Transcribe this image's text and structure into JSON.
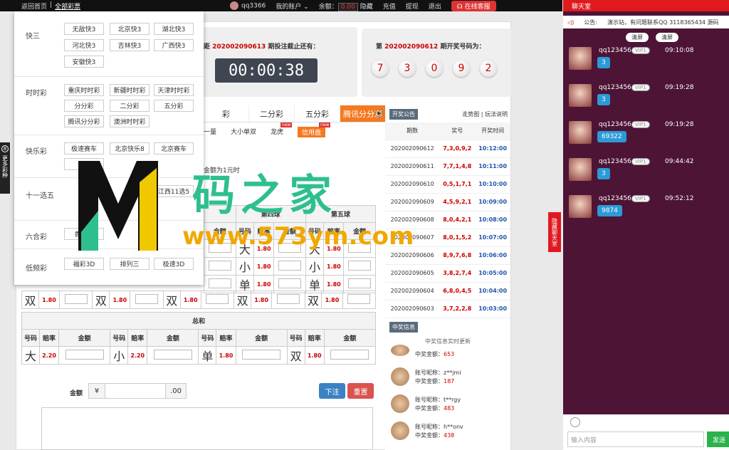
{
  "topbar": {
    "home": "返回首页",
    "sep": "|",
    "all_lottery": "全部彩票",
    "username": "qq3366",
    "my_account": "我的账户",
    "balance_label": "余额：",
    "balance_value": "0.00",
    "hide": "隐藏",
    "recharge": "充值",
    "withdraw": "提现",
    "logout": "退出",
    "service": "在线客服"
  },
  "menu": {
    "groups": [
      {
        "label": "快三",
        "items": [
          "无敌快3",
          "北京快3",
          "湖北快3",
          "河北快3",
          "吉林快3",
          "广西快3",
          "安徽快3"
        ]
      },
      {
        "label": "时时彩",
        "items": [
          "重庆时时彩",
          "新疆时时彩",
          "天津时时彩",
          "分分彩",
          "二分彩",
          "五分彩",
          "腾讯分分彩",
          "澳洲时时彩"
        ]
      },
      {
        "label": "快乐彩",
        "items": [
          "极速赛车",
          "北京快乐8",
          "北京赛车",
          "乐8",
          "",
          "",
          ""
        ]
      },
      {
        "label": "十一选五",
        "items": [
          "",
          "",
          "江西11选5",
          ""
        ]
      },
      {
        "label": "六合彩",
        "items": [
          "香港六",
          "",
          "",
          ""
        ]
      },
      {
        "label": "低频彩",
        "items": [
          "福彩3D",
          "排列三",
          "极速3D"
        ]
      }
    ]
  },
  "sidetag": {
    "num": "8",
    "text": "更多彩种"
  },
  "countdown": {
    "prefix": "距",
    "issue": "202002090613",
    "suffix": "期投注截止还有：",
    "h": "00",
    "m": "00",
    "s": "38"
  },
  "draw": {
    "prefix": "第",
    "issue": "202002090612",
    "suffix": "期开奖号码为：",
    "balls": [
      "7",
      "3",
      "0",
      "9",
      "2"
    ]
  },
  "tabs": [
    "彩",
    "二分彩",
    "五分彩",
    "腾讯分分彩"
  ],
  "subtabs": {
    "a": "一量",
    "b": "大小单双",
    "c": "龙虎",
    "d": "信用盘",
    "new": "new"
  },
  "bet_hint": "金额为1元时",
  "table1": {
    "col4": "第四球",
    "col5": "第五球",
    "h_num": "号码",
    "h_odds": "赔率",
    "h_amt": "金额",
    "rows": [
      {
        "code": "大",
        "odds": "1.80"
      },
      {
        "code": "小",
        "odds": "1.80"
      },
      {
        "code": "单",
        "odds": "1.80"
      },
      {
        "code": "双",
        "odds": "1.80"
      }
    ]
  },
  "table2": {
    "title": "总和",
    "h_num": "号码",
    "h_odds": "赔率",
    "h_amt": "金额",
    "cells": [
      {
        "code": "大",
        "odds": "2.20"
      },
      {
        "code": "小",
        "odds": "2.20"
      },
      {
        "code": "单",
        "odds": "1.80"
      },
      {
        "code": "双",
        "odds": "1.80"
      }
    ]
  },
  "amount": {
    "label": "金额",
    "currency": "¥",
    "decimal": ".00",
    "bet": "下注",
    "reset": "重置"
  },
  "results": {
    "notice_btn": "开奖公告",
    "links": "走势图 | 玩法说明",
    "h_issue": "期数",
    "h_num": "奖号",
    "h_time": "开奖时间",
    "rows": [
      {
        "issue": "202002090612",
        "num": "7,3,0,9,2",
        "time": "10:12:00"
      },
      {
        "issue": "202002090611",
        "num": "7,7,1,4,8",
        "time": "10:11:00"
      },
      {
        "issue": "202002090610",
        "num": "0,5,1,7,1",
        "time": "10:10:00"
      },
      {
        "issue": "202002090609",
        "num": "4,5,9,2,1",
        "time": "10:09:00"
      },
      {
        "issue": "202002090608",
        "num": "8,0,4,2,1",
        "time": "10:08:00"
      },
      {
        "issue": "202002090607",
        "num": "8,0,1,5,2",
        "time": "10:07:00"
      },
      {
        "issue": "202002090606",
        "num": "8,9,7,6,8",
        "time": "10:06:00"
      },
      {
        "issue": "202002090605",
        "num": "3,8,2,7,4",
        "time": "10:05:00"
      },
      {
        "issue": "202002090604",
        "num": "6,8,0,4,5",
        "time": "10:04:00"
      },
      {
        "issue": "202002090603",
        "num": "3,7,2,2,8",
        "time": "10:03:00"
      }
    ]
  },
  "wins": {
    "btn": "中奖信息",
    "sub": "中奖信息实时更新",
    "rows": [
      {
        "name": "",
        "label": "中奖金额：",
        "amt": "653"
      },
      {
        "name": "账号昵称：z**jmi",
        "label": "中奖金额：",
        "amt": "187"
      },
      {
        "name": "账号昵称：t**rgy",
        "label": "中奖金额：",
        "amt": "483"
      },
      {
        "name": "账号昵称：h**onv",
        "label": "中奖金额：",
        "amt": "438"
      }
    ]
  },
  "watermark": {
    "main": "码之家",
    "url": "www.573ym.com"
  },
  "chat": {
    "title": "聊天室",
    "notice_label": "公告:",
    "notice_text": "演示站，有问题联系QQ 3118365434 源码",
    "clear": "清屏",
    "clear2": "清屏",
    "hide_label": "隐藏聊天室",
    "messages": [
      {
        "user": "qq123456",
        "vip": "VIP1",
        "time": "09:10:08",
        "text": "3"
      },
      {
        "user": "qq123456",
        "vip": "VIP1",
        "time": "09:19:28",
        "text": "3"
      },
      {
        "user": "qq123456",
        "vip": "VIP1",
        "time": "09:19:28",
        "text": "69322"
      },
      {
        "user": "qq123456",
        "vip": "VIP1",
        "time": "09:44:42",
        "text": "3"
      },
      {
        "user": "qq123456",
        "vip": "VIP1",
        "time": "09:52:12",
        "text": "9874"
      }
    ],
    "placeholder": "输入内容",
    "send": "发送"
  }
}
